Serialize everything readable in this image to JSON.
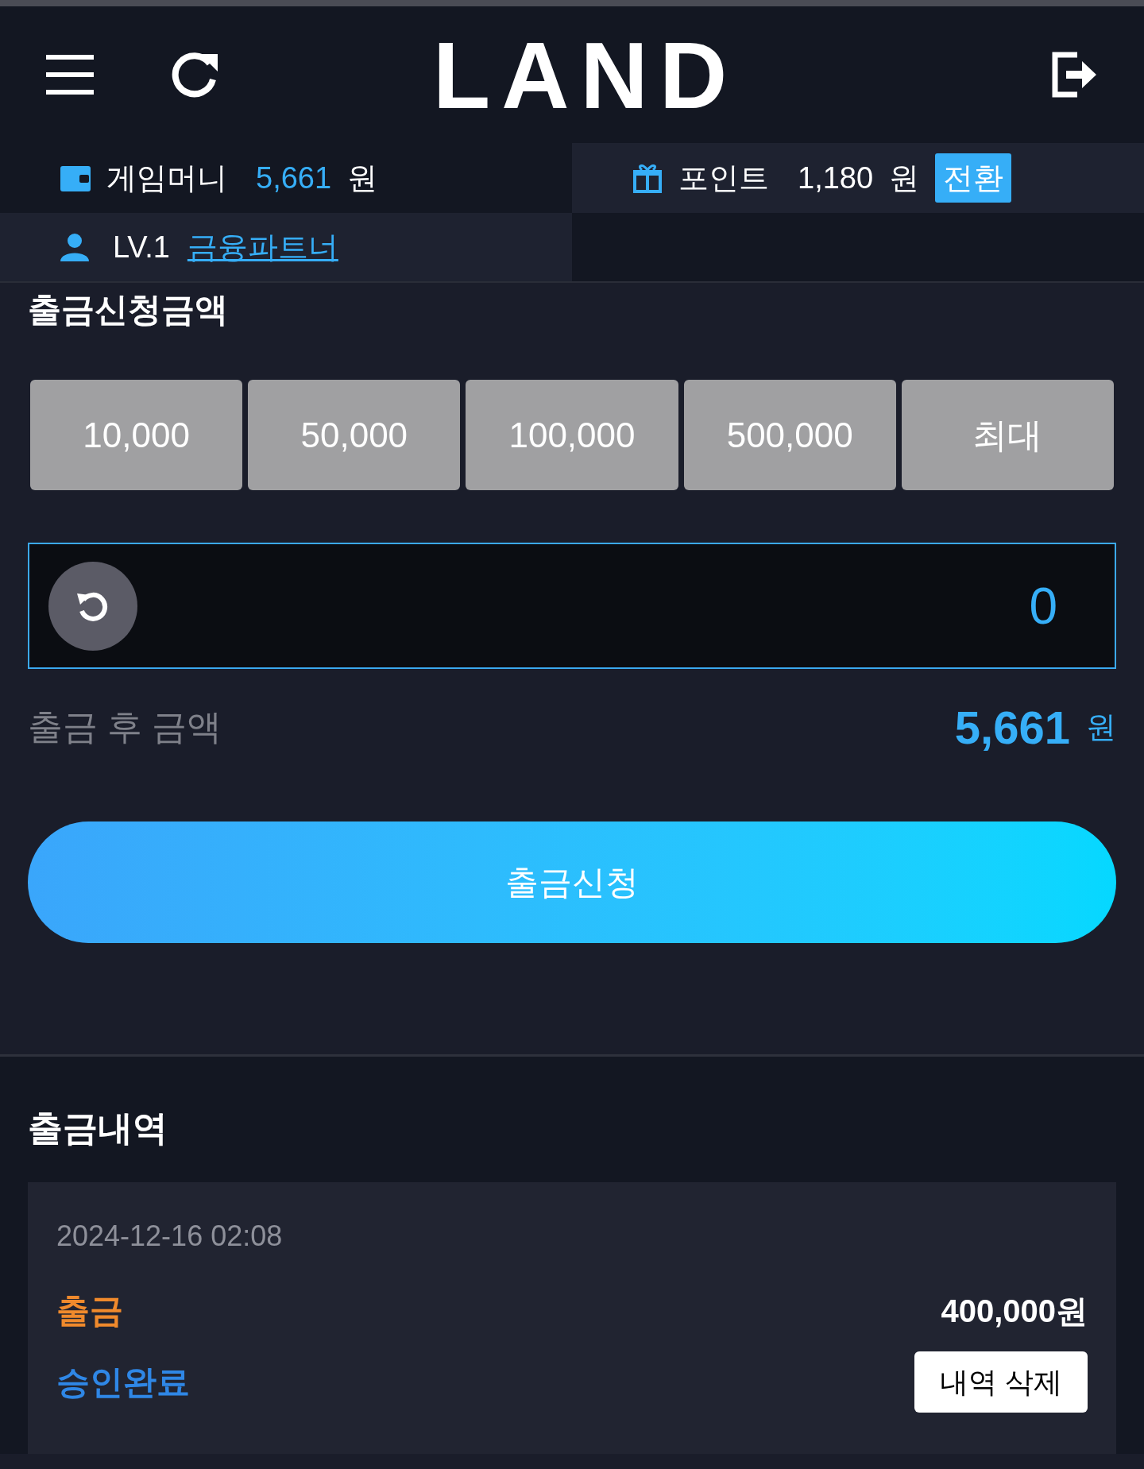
{
  "header": {
    "logo": "LAND"
  },
  "balance": {
    "money_label": "게임머니",
    "money_amount": "5,661",
    "money_unit": "원",
    "point_label": "포인트",
    "point_amount": "1,180",
    "point_unit": "원",
    "convert_button": "전환",
    "level": "LV.1",
    "grade": "금융파트너"
  },
  "withdraw": {
    "title": "출금신청금액",
    "quick_amounts": [
      "10,000",
      "50,000",
      "100,000",
      "500,000",
      "최대"
    ],
    "amount_value": "0",
    "after_label": "출금 후 금액",
    "after_amount": "5,661",
    "after_unit": "원",
    "submit": "출금신청"
  },
  "history": {
    "title": "출금내역",
    "entries": [
      {
        "date": "2024-12-16 02:08",
        "type": "출금",
        "amount": "400,000원",
        "status": "승인완료",
        "delete_button": "내역 삭제"
      }
    ]
  }
}
